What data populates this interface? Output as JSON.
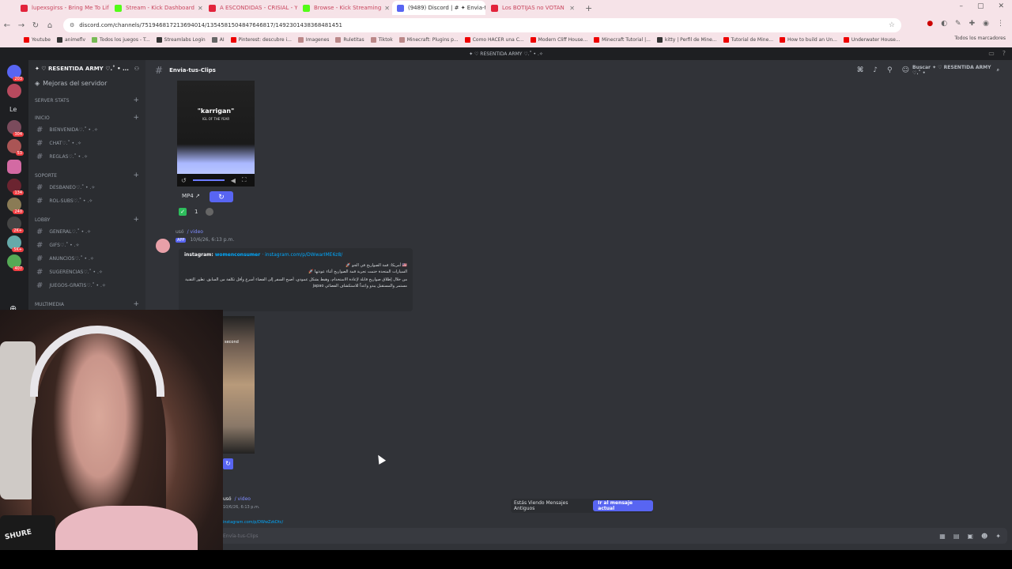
{
  "browser": {
    "tabs": [
      {
        "title": "lupexsgirss - Bring Me To Life",
        "color": "#e2233b",
        "active": false
      },
      {
        "title": "Stream - Kick Dashboard",
        "color": "#53fc18",
        "active": false
      },
      {
        "title": "A ESCONDIDAS - CRISIAL - Yo",
        "color": "#e2233b",
        "active": false
      },
      {
        "title": "Browse - Kick Streaming",
        "color": "#53fc18",
        "active": false
      },
      {
        "title": "(9489) Discord | # ✦ Envia-tu",
        "color": "#5865f2",
        "active": true
      },
      {
        "title": "Los BOTIJAS no VOTAN",
        "color": "#e2233b",
        "active": false
      }
    ],
    "url": "discord.com/channels/751946817213694014/1354581504847646817/1492301438368481451",
    "bookmarks": [
      "Youtube",
      "animeflv",
      "Todos los juegos - T...",
      "Streamlabs Login",
      "AI",
      "Pinterest: descubre i...",
      "Imagenes",
      "Ruletitas",
      "Tiktok",
      "Minecraft: Plugins p...",
      "Como HACER una C...",
      "Modern Cliff House...",
      "Minecraft Tutorial |...",
      "kitty | Perfil de Mine...",
      "Tutorial de Mine...",
      "How to build an Un...",
      "Underwater House..."
    ],
    "all_bookmarks": "Todos los marcadores"
  },
  "discord": {
    "title": "✦ ♡ RESENTIDA ARMY ♡.˚ • .✧",
    "server_name": "✦ ♡ RESENTIDA ARMY ♡.˚ • ...",
    "boost_label": "Mejoras del servidor",
    "categories": [
      {
        "name": "SERVER STATS",
        "channels": []
      },
      {
        "name": "INICIO",
        "channels": [
          "BIENVENIDA♡.˚ • .✧",
          "CHAT♡.˚ • .✧",
          "REGLAS♡.˚ • .✧"
        ]
      },
      {
        "name": "SOPORTE",
        "channels": [
          "DESBANEO♡.˚ • .✧",
          "ROL-SUBS♡.˚ • .✧"
        ]
      },
      {
        "name": "LOBBY",
        "channels": [
          "GENERAL♡.˚ • .✧",
          "GIFS♡.˚ • .✧",
          "ANUNCIOS♡.˚ • .✧",
          "SUGERENCIAS♡.˚ • .✧",
          "JUEGOS-GRATIS♡.˚ • .✧"
        ]
      },
      {
        "name": "MULTIMEDIA",
        "channels": []
      }
    ],
    "channel_name": "Envia-tus-Clips",
    "search_placeholder": "Buscar ✦ ♡ RESENTIDA ARMY ♡.˚ •",
    "video1": {
      "title": "\"karrigan\"",
      "subtitle": "IGL OF THE YEAR"
    },
    "mp4_label": "MP4",
    "reaction_count": "1",
    "message": {
      "used": "usó",
      "command": "/ video",
      "app_tag": "APP",
      "timestamp": "10/6/26, 6:13 p.m.",
      "embed_source": "instagram:",
      "embed_account": "womenconsumer",
      "embed_link": "instagram.com/p/DWwarIME6z8/",
      "embed_line1": "🇺🇸 أمريكا: قمة الصواريخ في الجو 🚀",
      "embed_line2": "السيارات المتحدة ختمت تجربة قمة الصواريخ أثناء عودتها 🚀",
      "embed_body": "من خلال إطلاق صواريخ قابلة لإعادة الاستخدام، وهبط بشكل عمودي، أصبح السفر إلى الفضاء أسرع وأقل تكلفة من السابق. تطور التقنية مستمر والمستقبل يبدو واعداً للاستكشاف الفضائي japao"
    },
    "video2_text": "second",
    "message2": {
      "used": "usó",
      "command": "/ video",
      "timestamp": "10/6/26, 6:13 p.m.",
      "link": "instagram.com/p/DWwZzkDtc/"
    },
    "old_messages": "Estás Viendo Mensajes Antiguos",
    "jump_button": "Ir al mensaje actual",
    "composer_placeholder": "Envía-tus-Clips",
    "mic_label": "SHURE"
  }
}
